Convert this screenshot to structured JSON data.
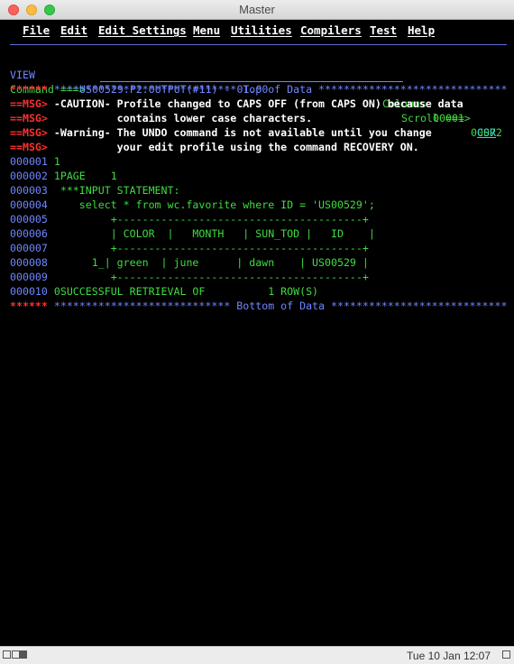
{
  "window": {
    "title": "Master"
  },
  "menu": {
    "items": [
      "File",
      "Edit",
      "Edit_Settings",
      "Menu",
      "Utilities",
      "Compilers",
      "Test",
      "Help"
    ]
  },
  "header": {
    "mode": "VIEW",
    "dataset": "US00529.P2.OUTPUT(#11) - 01.00",
    "columns_label": "Columns",
    "columns_from": "00001",
    "columns_to": "00072",
    "command_label": "Command ===>",
    "command_value": "",
    "scroll_label": "Scroll ===>",
    "scroll_value": "CSR"
  },
  "lines": [
    {
      "prefix": "******",
      "text": " ***************************** Top of Data ******************************",
      "kind": "top"
    },
    {
      "prefix": "==MSG>",
      "text": " -CAUTION- Profile changed to CAPS OFF (from CAPS ON) because data",
      "kind": "msg"
    },
    {
      "prefix": "==MSG>",
      "text": "           contains lower case characters.",
      "kind": "msg"
    },
    {
      "prefix": "==MSG>",
      "text": " -Warning- The UNDO command is not available until you change",
      "kind": "msg"
    },
    {
      "prefix": "==MSG>",
      "text": "           your edit profile using the command RECOVERY ON.",
      "kind": "msg"
    },
    {
      "prefix": "000001",
      "text": " 1",
      "kind": "data"
    },
    {
      "prefix": "000002",
      "text": " 1PAGE    1",
      "kind": "data"
    },
    {
      "prefix": "000003",
      "text": "  ***INPUT STATEMENT:",
      "kind": "data"
    },
    {
      "prefix": "000004",
      "text": "     select * from wc.favorite where ID = 'US00529';",
      "kind": "data"
    },
    {
      "prefix": "000005",
      "text": "          +---------------------------------------+",
      "kind": "data"
    },
    {
      "prefix": "000006",
      "text": "          | COLOR  |   MONTH   | SUN_TOD |   ID    |",
      "kind": "data"
    },
    {
      "prefix": "000007",
      "text": "          +---------------------------------------+",
      "kind": "data"
    },
    {
      "prefix": "000008",
      "text": "       1_| green  | june      | dawn    | US00529 |",
      "kind": "data"
    },
    {
      "prefix": "000009",
      "text": "          +---------------------------------------+",
      "kind": "data"
    },
    {
      "prefix": "000010",
      "text": " 0SUCCESSFUL RETRIEVAL OF          1 ROW(S)",
      "kind": "data"
    },
    {
      "prefix": "******",
      "text": " **************************** Bottom of Data ****************************",
      "kind": "bottom"
    }
  ],
  "statusbar": {
    "clock": "Tue 10 Jan 12:07"
  }
}
